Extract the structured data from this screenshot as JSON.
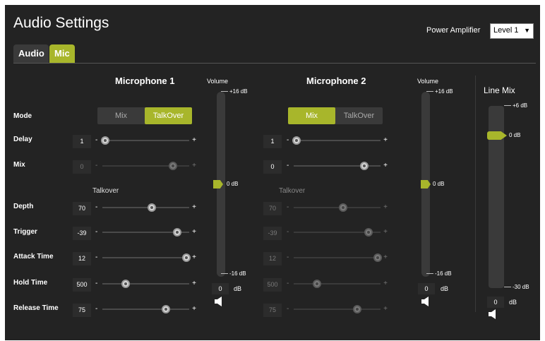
{
  "title": "Audio Settings",
  "power_amplifier": {
    "label": "Power Amplifier",
    "value": "Level 1"
  },
  "tabs": [
    {
      "label": "Audio"
    },
    {
      "label": "Mic"
    }
  ],
  "row_labels": {
    "mode": "Mode",
    "delay": "Delay",
    "mix": "Mix",
    "talkover": "Talkover",
    "depth": "Depth",
    "trigger": "Trigger",
    "attack": "Attack Time",
    "hold": "Hold Time",
    "release": "Release Time"
  },
  "mode_options": [
    "Mix",
    "TalkOver"
  ],
  "mic1": {
    "title": "Microphone 1",
    "mode_selected": "TalkOver",
    "delay": "1",
    "mix": "0",
    "depth": "70",
    "trigger": "-39",
    "attack": "12",
    "hold": "500",
    "release": "75",
    "talkover_label": "Talkover",
    "volume": {
      "label": "Volume",
      "max": "+16 dB",
      "mid": "0 dB",
      "min": "-16 dB",
      "value": "0",
      "unit": "dB"
    }
  },
  "mic2": {
    "title": "Microphone 2",
    "mode_selected": "Mix",
    "delay": "1",
    "mix": "0",
    "depth": "70",
    "trigger": "-39",
    "attack": "12",
    "hold": "500",
    "release": "75",
    "talkover_label": "Talkover",
    "volume": {
      "label": "Volume",
      "max": "+16 dB",
      "mid": "0 dB",
      "min": "-16 dB",
      "value": "0",
      "unit": "dB"
    }
  },
  "line_mix": {
    "title": "Line Mix",
    "max": "+6 dB",
    "mid": "0 dB",
    "min": "-30 dB",
    "value": "0",
    "unit": "dB"
  },
  "slider_symbols": {
    "minus": "-",
    "plus": "+"
  },
  "icons": {
    "speaker": "speaker-icon",
    "dropdown": "chevron-down-icon"
  },
  "colors": {
    "accent": "#a8b62b",
    "background": "#232323"
  }
}
